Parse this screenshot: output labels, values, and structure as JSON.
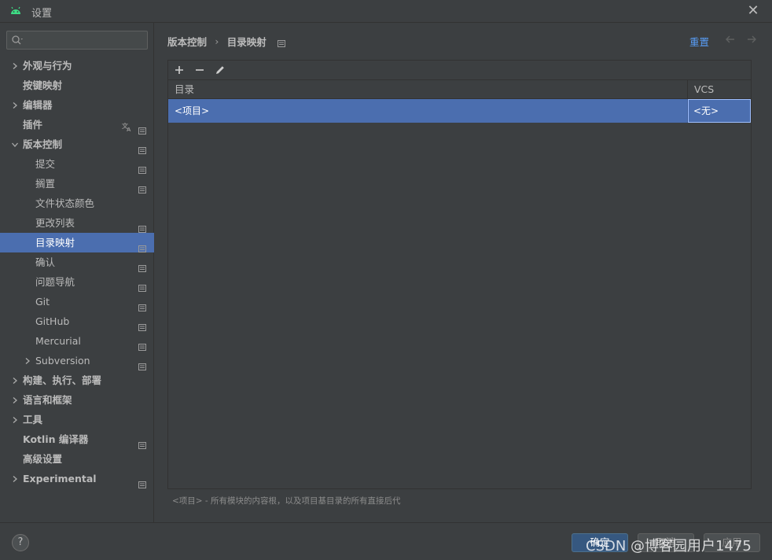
{
  "window": {
    "title": "设置",
    "app_icon": "android-icon",
    "close_icon": "close-icon"
  },
  "sidebar": {
    "search": {
      "placeholder": "",
      "value": ""
    },
    "items": [
      {
        "label": "外观与行为",
        "level": 0,
        "expandable": true,
        "expanded": false,
        "bold": true,
        "project_icon": false,
        "lang_icon": false,
        "selected": false
      },
      {
        "label": "按键映射",
        "level": 0,
        "expandable": false,
        "bold": true,
        "project_icon": false,
        "lang_icon": false,
        "selected": false
      },
      {
        "label": "编辑器",
        "level": 0,
        "expandable": true,
        "expanded": false,
        "bold": true,
        "project_icon": false,
        "lang_icon": false,
        "selected": false
      },
      {
        "label": "插件",
        "level": 0,
        "expandable": false,
        "bold": true,
        "project_icon": true,
        "lang_icon": true,
        "selected": false
      },
      {
        "label": "版本控制",
        "level": 0,
        "expandable": true,
        "expanded": true,
        "bold": true,
        "project_icon": true,
        "lang_icon": false,
        "selected": false
      },
      {
        "label": "提交",
        "level": 1,
        "expandable": false,
        "bold": false,
        "project_icon": true,
        "lang_icon": false,
        "selected": false
      },
      {
        "label": "搁置",
        "level": 1,
        "expandable": false,
        "bold": false,
        "project_icon": true,
        "lang_icon": false,
        "selected": false
      },
      {
        "label": "文件状态颜色",
        "level": 1,
        "expandable": false,
        "bold": false,
        "project_icon": false,
        "lang_icon": false,
        "selected": false
      },
      {
        "label": "更改列表",
        "level": 1,
        "expandable": false,
        "bold": false,
        "project_icon": true,
        "lang_icon": false,
        "selected": false
      },
      {
        "label": "目录映射",
        "level": 1,
        "expandable": false,
        "bold": false,
        "project_icon": true,
        "lang_icon": false,
        "selected": true
      },
      {
        "label": "确认",
        "level": 1,
        "expandable": false,
        "bold": false,
        "project_icon": true,
        "lang_icon": false,
        "selected": false
      },
      {
        "label": "问题导航",
        "level": 1,
        "expandable": false,
        "bold": false,
        "project_icon": true,
        "lang_icon": false,
        "selected": false
      },
      {
        "label": "Git",
        "level": 1,
        "expandable": false,
        "bold": false,
        "project_icon": true,
        "lang_icon": false,
        "selected": false
      },
      {
        "label": "GitHub",
        "level": 1,
        "expandable": false,
        "bold": false,
        "project_icon": true,
        "lang_icon": false,
        "selected": false
      },
      {
        "label": "Mercurial",
        "level": 1,
        "expandable": false,
        "bold": false,
        "project_icon": true,
        "lang_icon": false,
        "selected": false
      },
      {
        "label": "Subversion",
        "level": 1,
        "expandable": true,
        "expanded": false,
        "bold": false,
        "project_icon": true,
        "lang_icon": false,
        "selected": false
      },
      {
        "label": "构建、执行、部署",
        "level": 0,
        "expandable": true,
        "expanded": false,
        "bold": true,
        "project_icon": false,
        "lang_icon": false,
        "selected": false
      },
      {
        "label": "语言和框架",
        "level": 0,
        "expandable": true,
        "expanded": false,
        "bold": true,
        "project_icon": false,
        "lang_icon": false,
        "selected": false
      },
      {
        "label": "工具",
        "level": 0,
        "expandable": true,
        "expanded": false,
        "bold": true,
        "project_icon": false,
        "lang_icon": false,
        "selected": false
      },
      {
        "label": "Kotlin 编译器",
        "level": 0,
        "expandable": false,
        "bold": true,
        "project_icon": true,
        "lang_icon": false,
        "selected": false
      },
      {
        "label": "高级设置",
        "level": 0,
        "expandable": false,
        "bold": true,
        "project_icon": false,
        "lang_icon": false,
        "selected": false
      },
      {
        "label": "Experimental",
        "level": 0,
        "expandable": true,
        "expanded": false,
        "bold": true,
        "project_icon": true,
        "lang_icon": false,
        "selected": false
      }
    ]
  },
  "main": {
    "breadcrumb": {
      "parent": "版本控制",
      "separator": "›",
      "current": "目录映射"
    },
    "reset_label": "重置",
    "toolbar": {
      "add_icon": "plus-icon",
      "remove_icon": "minus-icon",
      "edit_icon": "pencil-icon"
    },
    "table": {
      "columns": [
        "目录",
        "VCS"
      ],
      "rows": [
        {
          "directory": "<项目>",
          "vcs": "<无>"
        }
      ]
    },
    "hint": "<项目> - 所有模块的内容根，以及项目基目录的所有直接后代"
  },
  "footer": {
    "help_label": "?",
    "ok_label": "确定",
    "cancel_label": "取消",
    "apply_label": "应用"
  },
  "watermark": "CSDN @博客园用户1475",
  "colors": {
    "background": "#3c3f41",
    "selection": "#4b6eaf",
    "link": "#589df6",
    "android_green": "#3ddc84"
  }
}
